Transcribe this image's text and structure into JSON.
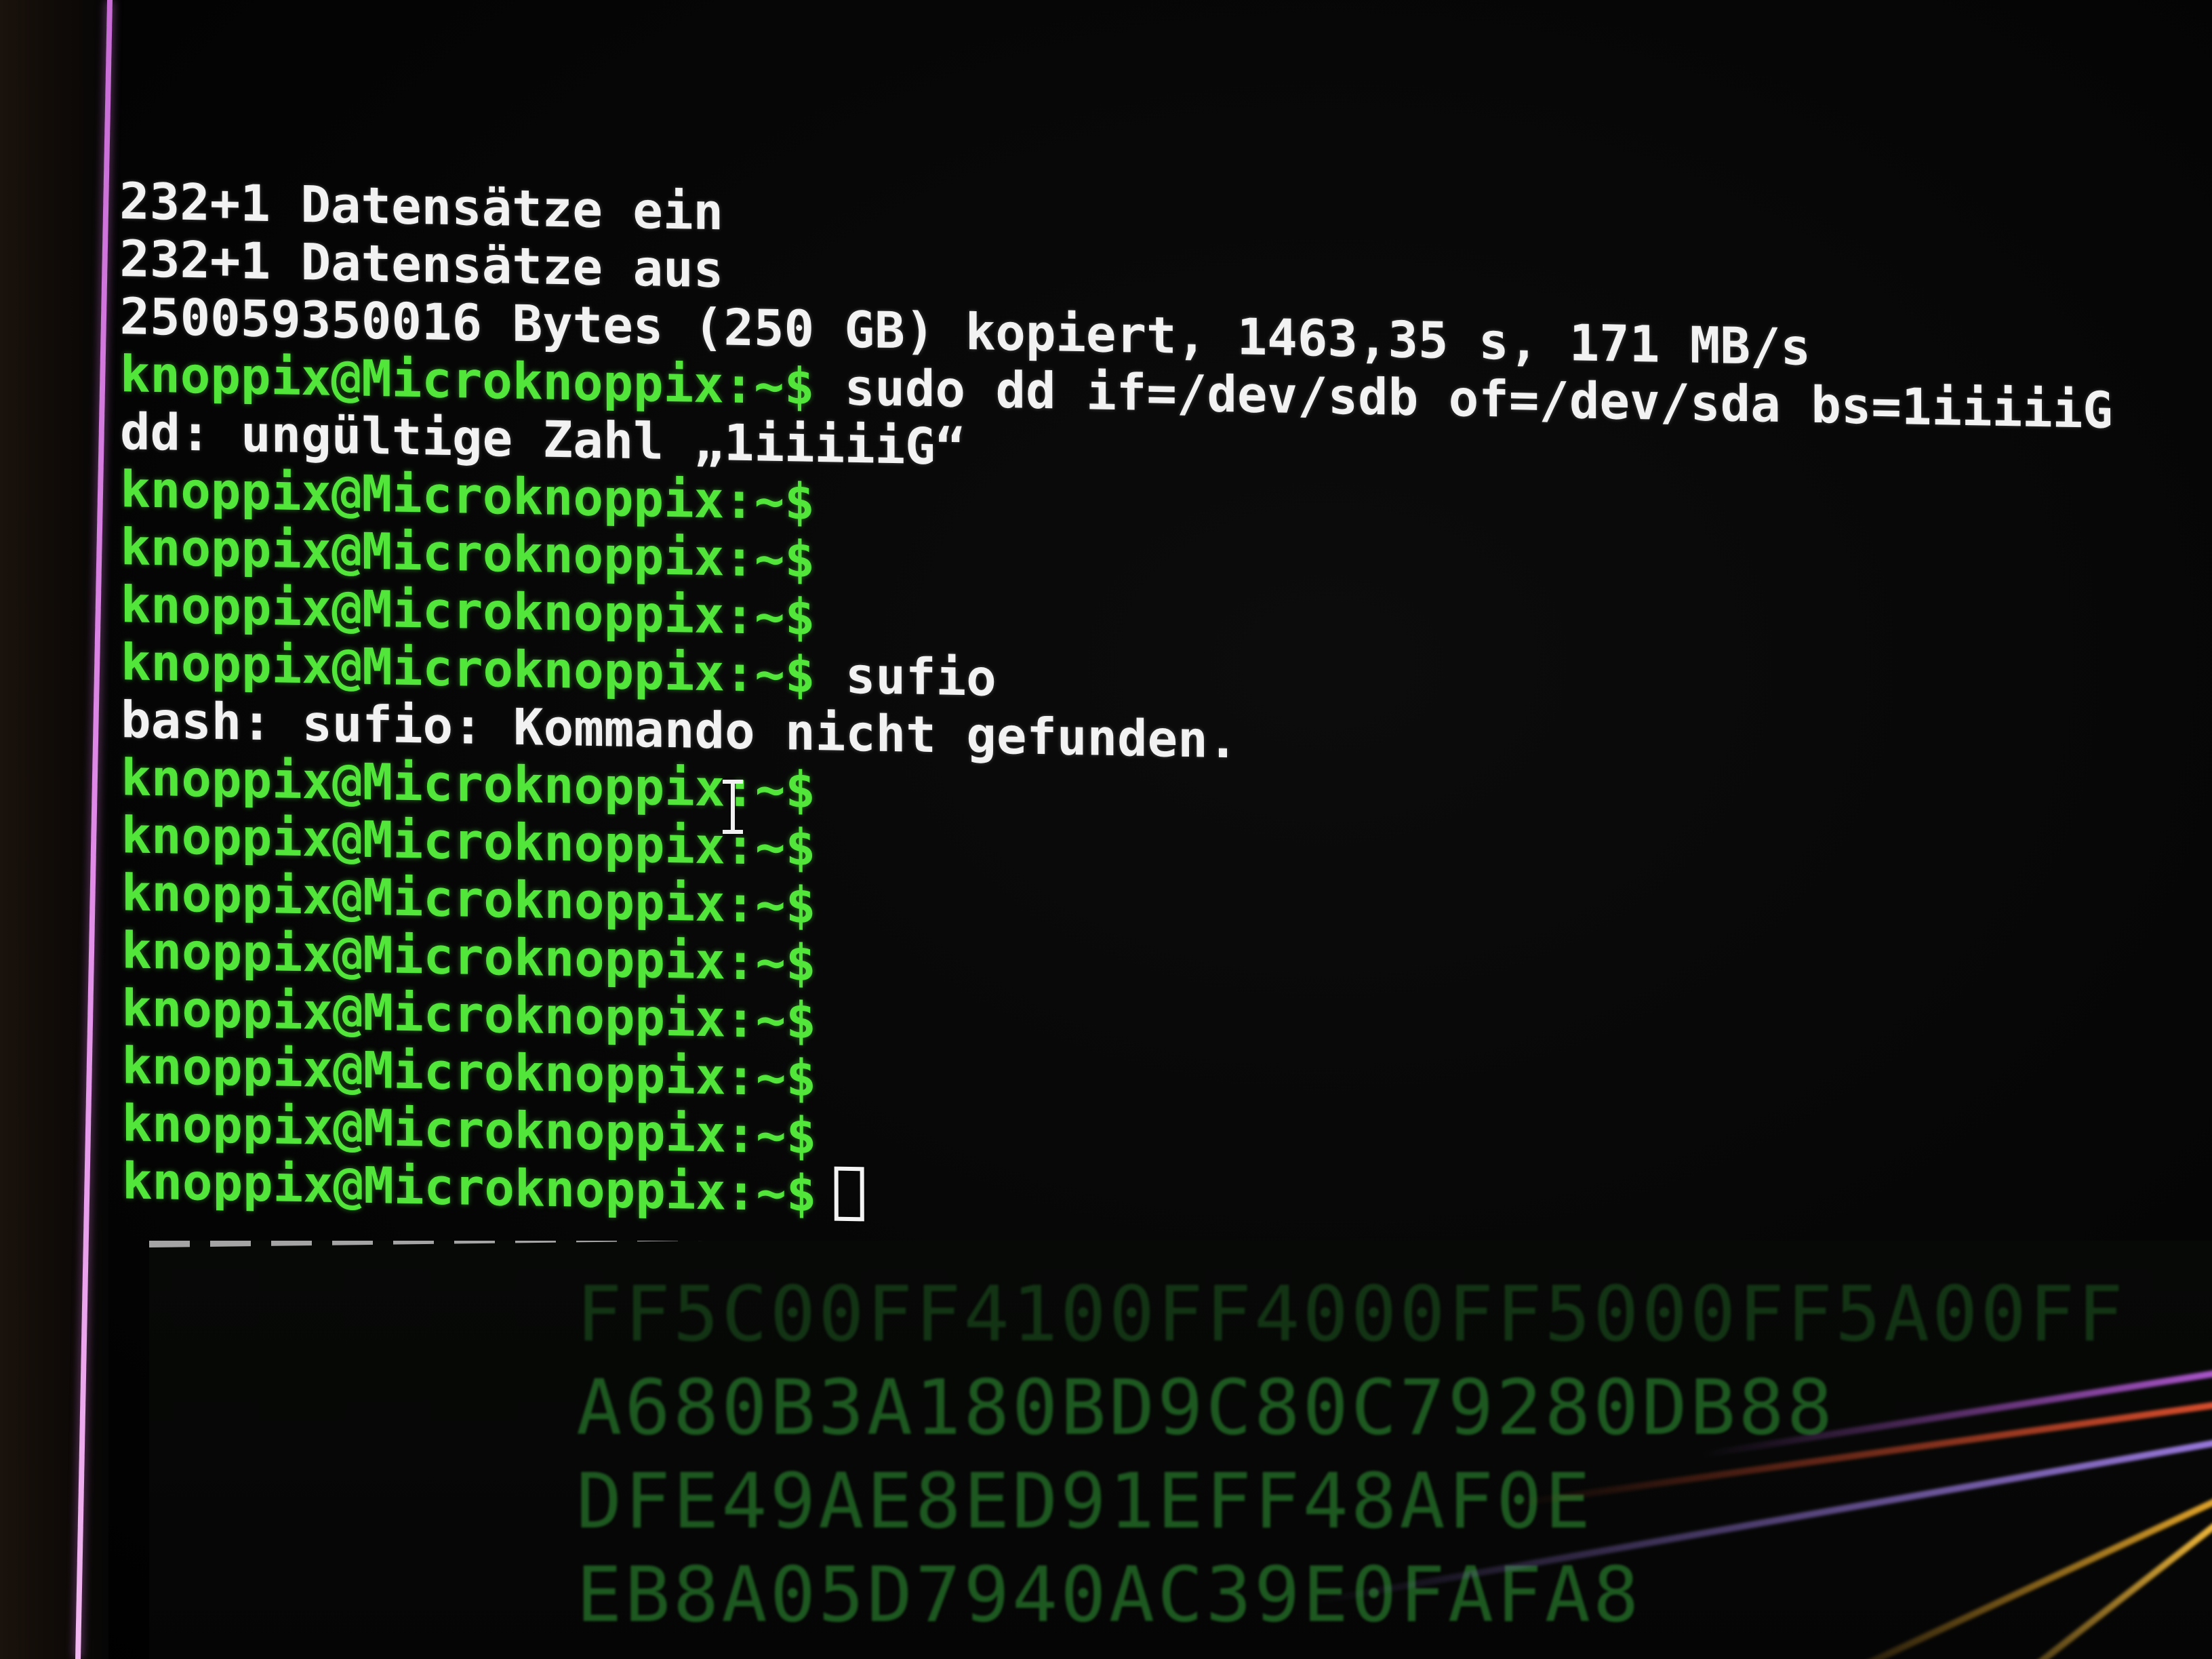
{
  "terminal": {
    "prompt": "knoppix@Microknoppix:~$",
    "lines": [
      {
        "type": "output",
        "text": "232+1 Datensätze ein"
      },
      {
        "type": "output",
        "text": "232+1 Datensätze aus"
      },
      {
        "type": "output",
        "text": "250059350016 Bytes (250 GB) kopiert, 1463,35 s, 171 MB/s"
      },
      {
        "type": "prompt",
        "command": "sudo dd if=/dev/sdb of=/dev/sda bs=1iiiiiG"
      },
      {
        "type": "output",
        "text": "dd: ungültige Zahl „1iiiiiG“"
      },
      {
        "type": "prompt",
        "command": ""
      },
      {
        "type": "prompt",
        "command": ""
      },
      {
        "type": "prompt",
        "command": ""
      },
      {
        "type": "prompt",
        "command": "sufio"
      },
      {
        "type": "output",
        "text": "bash: sufio: Kommando nicht gefunden."
      },
      {
        "type": "prompt",
        "command": ""
      },
      {
        "type": "prompt",
        "command": ""
      },
      {
        "type": "prompt",
        "command": ""
      },
      {
        "type": "prompt",
        "command": ""
      },
      {
        "type": "prompt",
        "command": ""
      },
      {
        "type": "prompt",
        "command": ""
      },
      {
        "type": "prompt",
        "command": ""
      },
      {
        "type": "prompt",
        "command": "",
        "cursor": true
      }
    ]
  },
  "background_window": {
    "hex_lines": [
      "FF5C00FF4100FF4000FF5000FF5A00FF",
      "A680B3A180BD9C80C79280DB88",
      "DFE49AE8ED91EFF48AF0E",
      "EB8A05D7940AC39E0FAFA8"
    ]
  },
  "colors": {
    "prompt": "#52e63a",
    "output": "#f2f2f2",
    "background": "#050505",
    "hex_text": "#1f5d22"
  }
}
